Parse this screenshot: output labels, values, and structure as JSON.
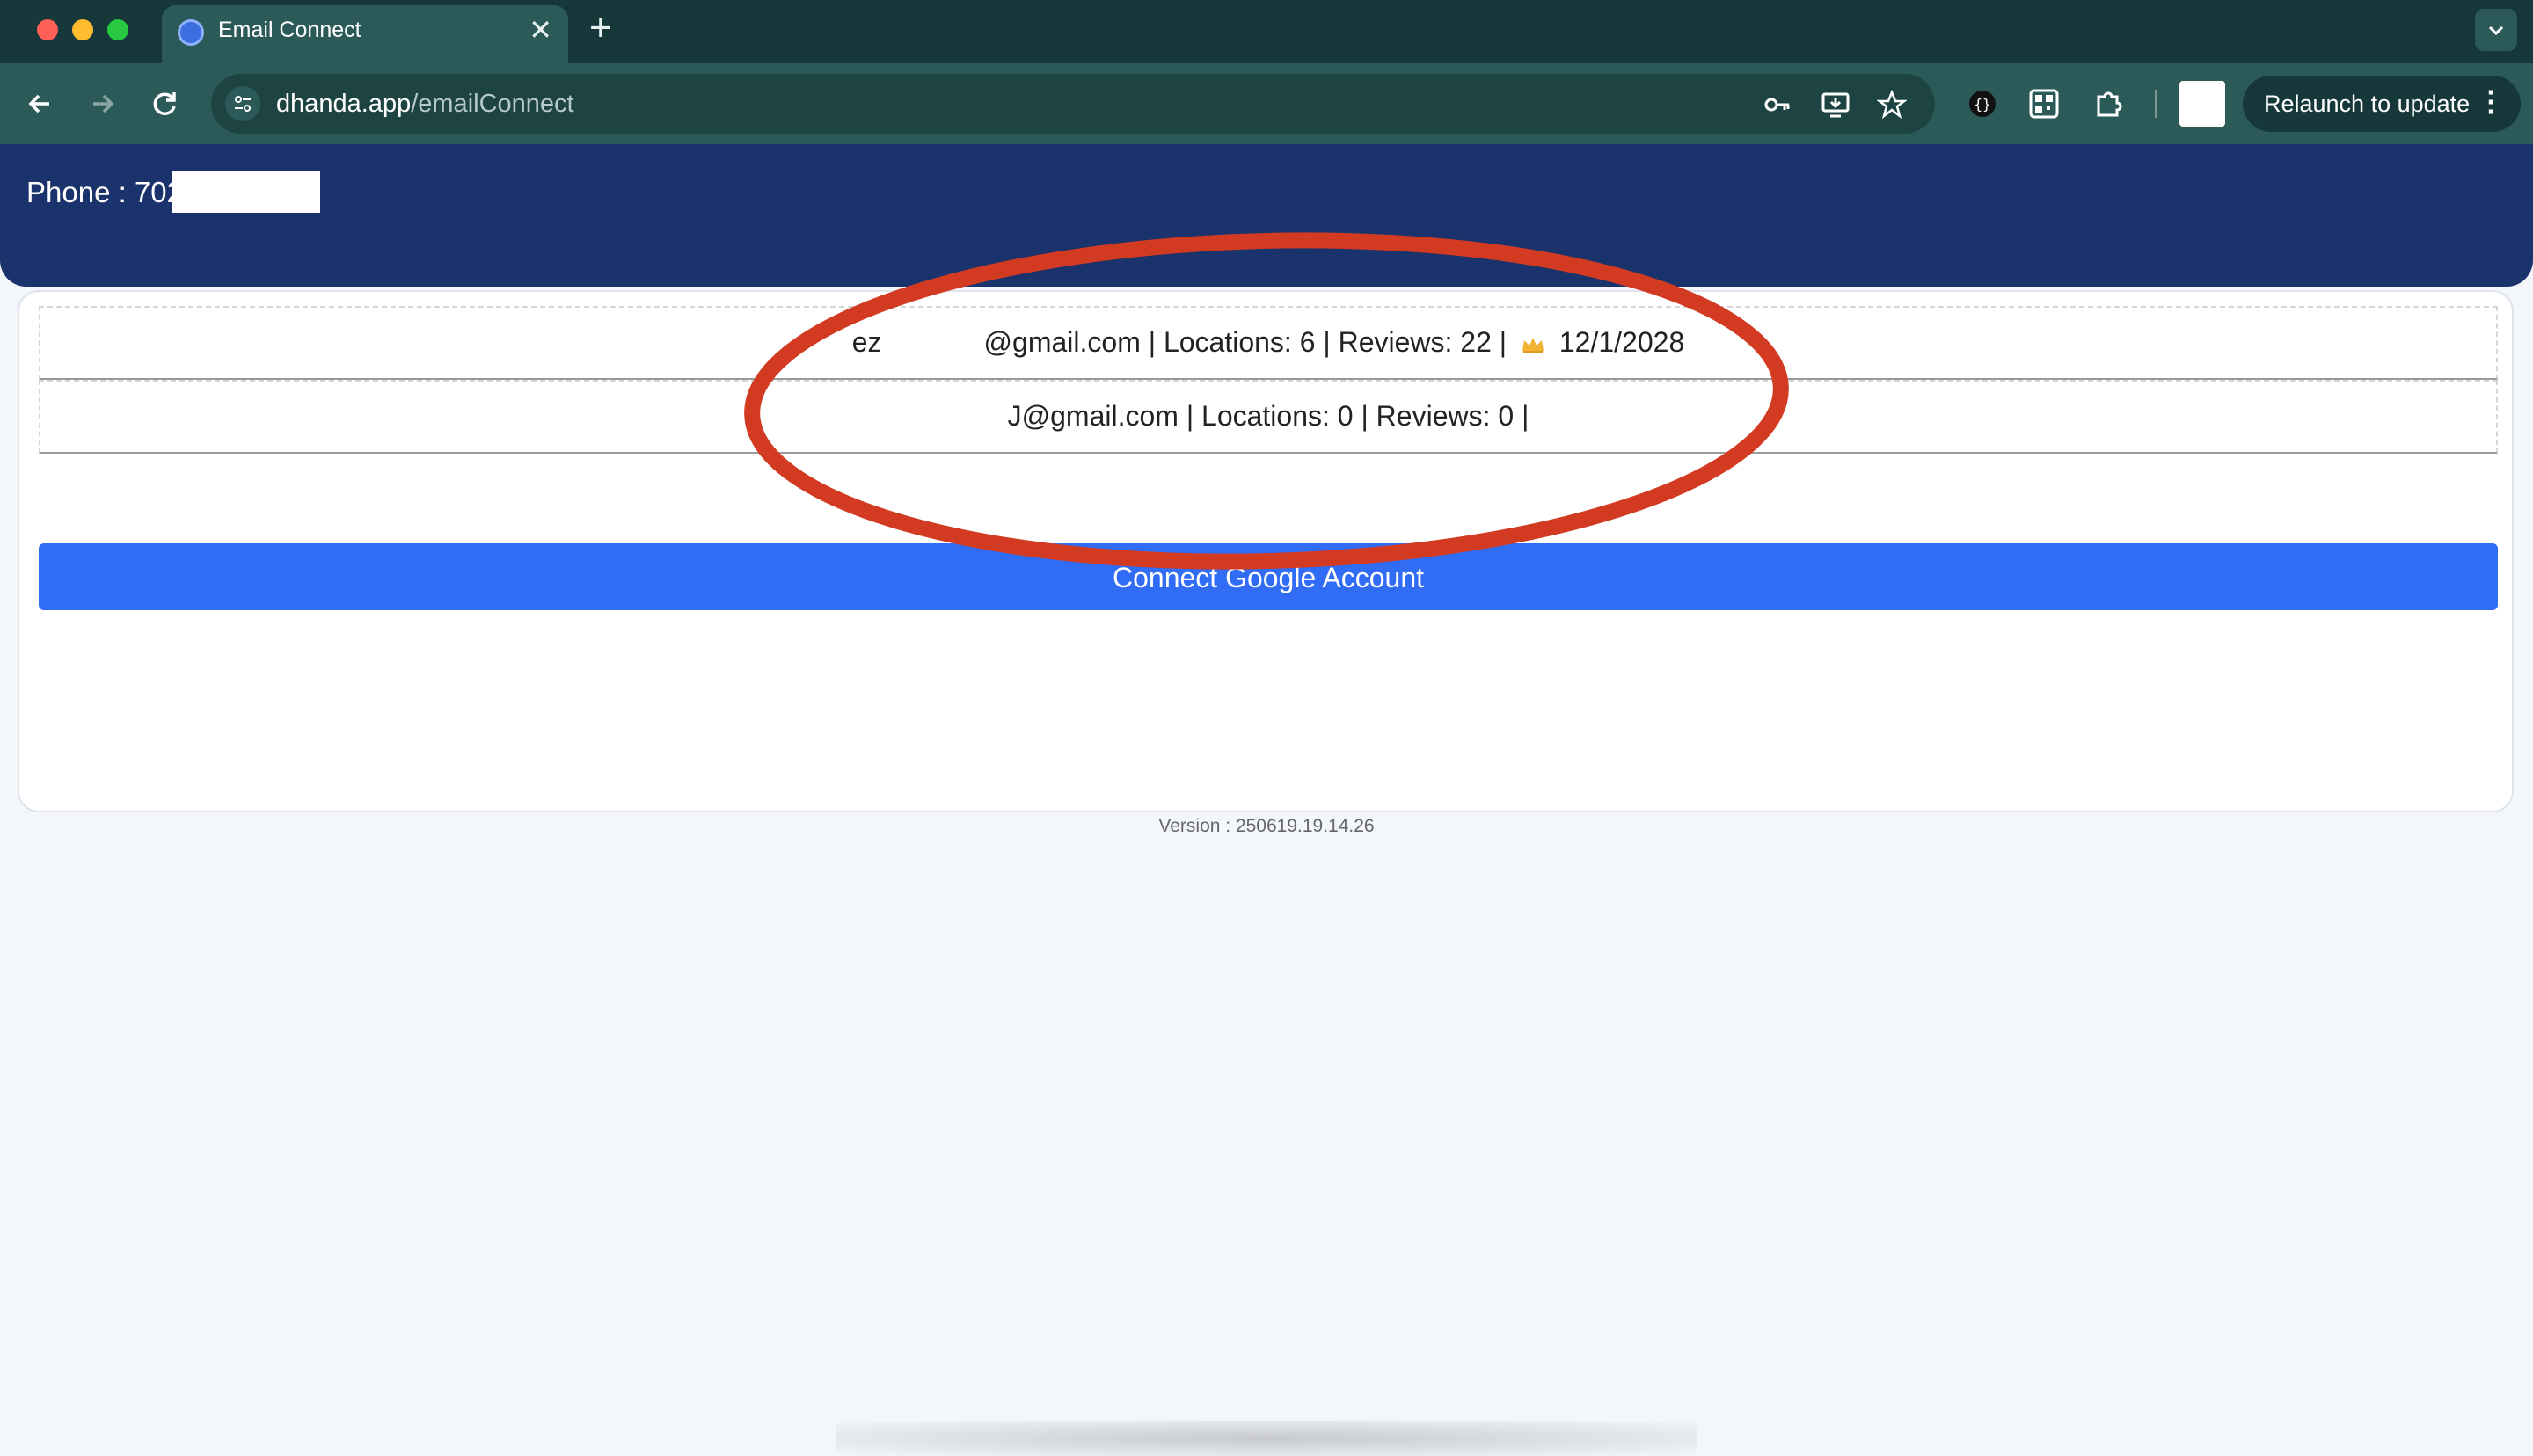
{
  "browser": {
    "tab_title": "Email Connect",
    "url_host": "dhanda.app",
    "url_path": "/emailConnect",
    "relaunch_label": "Relaunch to update"
  },
  "header": {
    "phone_label": "Phone : 702"
  },
  "accounts": [
    {
      "email_start": "ez",
      "email_end": "@gmail.com | Locations: 6 | Reviews: 22 |",
      "date": "12/1/2028"
    },
    {
      "email_end": "J@gmail.com | Locations: 0 | Reviews: 0 |"
    }
  ],
  "connect_button_label": "Connect Google Account",
  "version": "Version : 250619.19.14.26",
  "colors": {
    "header_bg": "#1b336c",
    "button_bg": "#316cf4",
    "annotation": "#d23a22",
    "chrome_bg": "#2b5a58"
  }
}
